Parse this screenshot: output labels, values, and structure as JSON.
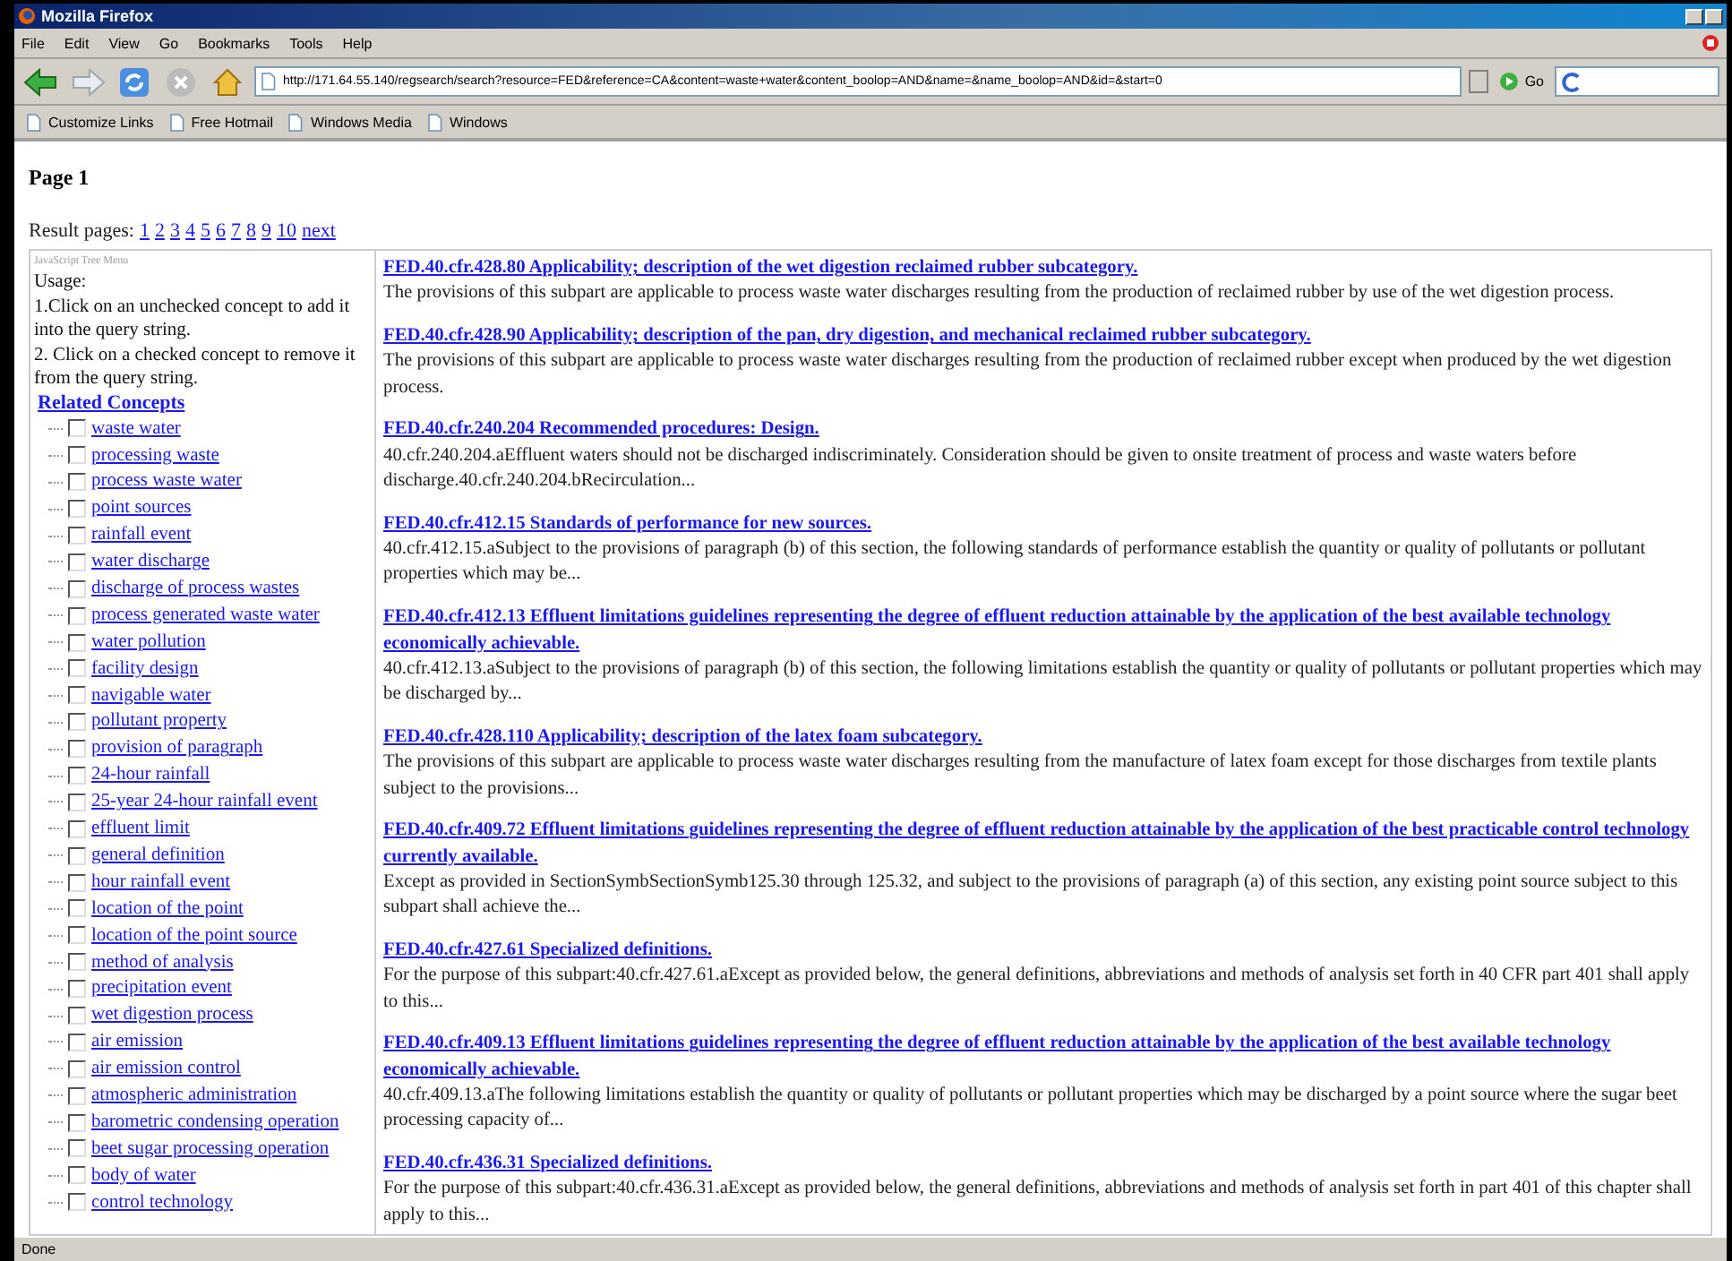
{
  "window": {
    "title": "Mozilla Firefox"
  },
  "menu": [
    "File",
    "Edit",
    "View",
    "Go",
    "Bookmarks",
    "Tools",
    "Help"
  ],
  "toolbar": {
    "url": "http://171.64.55.140/regsearch/search?resource=FED&reference=CA&content=waste+water&content_boolop=AND&name=&name_boolop=AND&id=&start=0",
    "go": "Go"
  },
  "bookmarks": [
    "Customize Links",
    "Free Hotmail",
    "Windows Media",
    "Windows"
  ],
  "page": {
    "heading": "Page 1",
    "result_pages_label": "Result pages:",
    "result_pages": [
      "1",
      "2",
      "3",
      "4",
      "5",
      "6",
      "7",
      "8",
      "9",
      "10"
    ],
    "next": "next"
  },
  "sidebar": {
    "header": "JavaScript Tree Menu",
    "usage_title": "Usage:",
    "usage": [
      "1.Click on an unchecked concept to add it into the query string.",
      "2. Click on a checked concept to remove it from the query string."
    ],
    "related_title": "Related Concepts",
    "concepts": [
      {
        "label": "waste water",
        "checked": false
      },
      {
        "label": "processing waste",
        "checked": false
      },
      {
        "label": "process waste water",
        "checked": false
      },
      {
        "label": "point sources",
        "checked": false
      },
      {
        "label": "rainfall event",
        "checked": false
      },
      {
        "label": "water discharge",
        "checked": false
      },
      {
        "label": "discharge of process wastes",
        "checked": false
      },
      {
        "label": "process generated waste water",
        "checked": false
      },
      {
        "label": "water pollution",
        "checked": false
      },
      {
        "label": "facility design",
        "checked": false
      },
      {
        "label": "navigable water",
        "checked": false
      },
      {
        "label": "pollutant property",
        "checked": false
      },
      {
        "label": "provision of paragraph",
        "checked": false
      },
      {
        "label": "24-hour rainfall",
        "checked": false
      },
      {
        "label": "25-year 24-hour rainfall event",
        "checked": false
      },
      {
        "label": "effluent limit",
        "checked": false
      },
      {
        "label": "general definition",
        "checked": false
      },
      {
        "label": "hour rainfall event",
        "checked": false
      },
      {
        "label": "location of the point",
        "checked": false
      },
      {
        "label": "location of the point source",
        "checked": false
      },
      {
        "label": "method of analysis",
        "checked": false
      },
      {
        "label": "precipitation event",
        "checked": false
      },
      {
        "label": "wet digestion process",
        "checked": false
      },
      {
        "label": "air emission",
        "checked": false
      },
      {
        "label": "air emission control",
        "checked": false
      },
      {
        "label": "atmospheric administration",
        "checked": false
      },
      {
        "label": "barometric condensing operation",
        "checked": false
      },
      {
        "label": "beet sugar processing operation",
        "checked": false
      },
      {
        "label": "body of water",
        "checked": false
      },
      {
        "label": "control technology",
        "checked": false
      }
    ]
  },
  "results": [
    {
      "title": "FED.40.cfr.428.80 Applicability; description of the wet digestion reclaimed rubber subcategory.",
      "snippet": "The provisions of this subpart are applicable to process waste water discharges resulting from the production of reclaimed rubber by use of the wet digestion process."
    },
    {
      "title": "FED.40.cfr.428.90 Applicability; description of the pan, dry digestion, and mechanical reclaimed rubber subcategory.",
      "snippet": "The provisions of this subpart are applicable to process waste water discharges resulting from the production of reclaimed rubber except when produced by the wet digestion process."
    },
    {
      "title": "FED.40.cfr.240.204 Recommended procedures: Design.",
      "snippet": "40.cfr.240.204.aEffluent waters should not be discharged indiscriminately. Consideration should be given to onsite treatment of process and waste waters before discharge.40.cfr.240.204.bRecirculation..."
    },
    {
      "title": "FED.40.cfr.412.15 Standards of performance for new sources.",
      "snippet": "40.cfr.412.15.aSubject to the provisions of paragraph (b) of this section, the following standards of performance establish the quantity or quality of pollutants or pollutant properties which may be..."
    },
    {
      "title": "FED.40.cfr.412.13 Effluent limitations guidelines representing the degree of effluent reduction attainable by the application of the best available technology economically achievable.",
      "snippet": "40.cfr.412.13.aSubject to the provisions of paragraph (b) of this section, the following limitations establish the quantity or quality of pollutants or pollutant properties which may be discharged by..."
    },
    {
      "title": "FED.40.cfr.428.110 Applicability; description of the latex foam subcategory.",
      "snippet": "The provisions of this subpart are applicable to process waste water discharges resulting from the manufacture of latex foam except for those discharges from textile plants subject to the provisions..."
    },
    {
      "title": "FED.40.cfr.409.72 Effluent limitations guidelines representing the degree of effluent reduction attainable by the application of the best practicable control technology currently available.",
      "snippet": "Except as provided in SectionSymbSectionSymb125.30 through 125.32, and subject to the provisions of paragraph (a) of this section, any existing point source subject to this subpart shall achieve the..."
    },
    {
      "title": "FED.40.cfr.427.61 Specialized definitions.",
      "snippet": "For the purpose of this subpart:40.cfr.427.61.aExcept as provided below, the general definitions, abbreviations and methods of analysis set forth in 40 CFR part 401 shall apply to this..."
    },
    {
      "title": "FED.40.cfr.409.13 Effluent limitations guidelines representing the degree of effluent reduction attainable by the application of the best available technology economically achievable.",
      "snippet": "40.cfr.409.13.aThe following limitations establish the quantity or quality of pollutants or pollutant properties which may be discharged by a point source where the sugar beet processing capacity of..."
    },
    {
      "title": "FED.40.cfr.436.31 Specialized definitions.",
      "snippet": "For the purpose of this subpart:40.cfr.436.31.aExcept as provided below, the general definitions, abbreviations and methods of analysis set forth in part 401 of this chapter shall apply to this..."
    }
  ],
  "status_bar": "Done"
}
